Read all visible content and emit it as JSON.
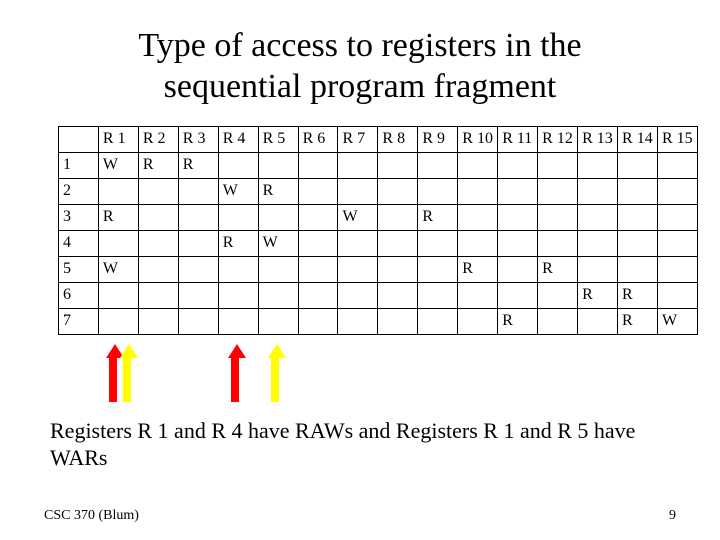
{
  "title_line1": "Type of access to registers in the",
  "title_line2": "sequential program fragment",
  "caption": "Registers R 1 and R 4 have RAWs and Registers R 1 and R 5 have WARs",
  "footer_left": "CSC 370 (Blum)",
  "footer_right": "9",
  "columns": [
    "R 1",
    "R 2",
    "R 3",
    "R 4",
    "R 5",
    "R 6",
    "R 7",
    "R 8",
    "R 9",
    "R 10",
    "R 11",
    "R 12",
    "R 13",
    "R 14",
    "R 15"
  ],
  "row_labels": [
    "1",
    "2",
    "3",
    "4",
    "5",
    "6",
    "7"
  ],
  "cells": {
    "r1": {
      "c1": "W",
      "c2": "R",
      "c3": "R"
    },
    "r2": {
      "c4": "W",
      "c5": "R"
    },
    "r3": {
      "c1": "R",
      "c7": "W",
      "c9": "R"
    },
    "r4": {
      "c4": "R",
      "c5": "W"
    },
    "r5": {
      "c1": "W",
      "c10": "R",
      "c12": "R"
    },
    "r6": {
      "c13": "R",
      "c14": "R"
    },
    "r7": {
      "c11": "R",
      "c14": "R",
      "c15": "W"
    }
  },
  "chart_data": {
    "type": "table",
    "title": "Type of access to registers in the sequential program fragment",
    "columns": [
      "R1",
      "R2",
      "R3",
      "R4",
      "R5",
      "R6",
      "R7",
      "R8",
      "R9",
      "R10",
      "R11",
      "R12",
      "R13",
      "R14",
      "R15"
    ],
    "rows": [
      {
        "row": 1,
        "R1": "W",
        "R2": "R",
        "R3": "R"
      },
      {
        "row": 2,
        "R4": "W",
        "R5": "R"
      },
      {
        "row": 3,
        "R1": "R",
        "R7": "W",
        "R9": "R"
      },
      {
        "row": 4,
        "R4": "R",
        "R5": "W"
      },
      {
        "row": 5,
        "R1": "W",
        "R10": "R",
        "R12": "R"
      },
      {
        "row": 6,
        "R13": "R",
        "R14": "R"
      },
      {
        "row": 7,
        "R11": "R",
        "R14": "R",
        "R15": "W"
      }
    ],
    "annotations": [
      {
        "register": "R1",
        "hazard": "RAW",
        "color": "red"
      },
      {
        "register": "R1",
        "hazard": "WAR",
        "color": "yellow"
      },
      {
        "register": "R4",
        "hazard": "RAW",
        "color": "red"
      },
      {
        "register": "R5",
        "hazard": "WAR",
        "color": "yellow"
      }
    ]
  }
}
